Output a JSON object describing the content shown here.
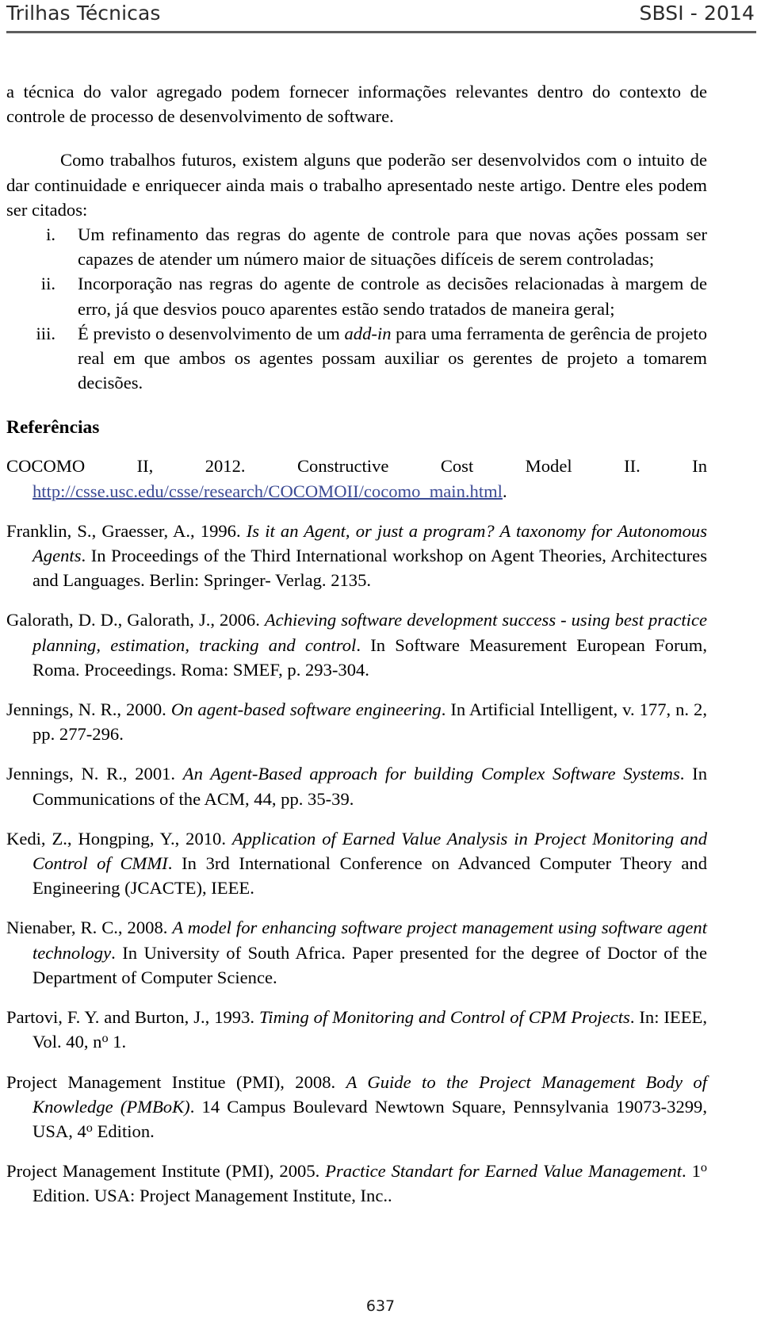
{
  "header": {
    "left": "Trilhas Técnicas",
    "right": "SBSI - 2014"
  },
  "body": {
    "paragraph_continued": "a técnica do valor agregado podem fornecer informações relevantes dentro do contexto de controle de processo de desenvolvimento de software.",
    "paragraph_future_work": "Como trabalhos futuros, existem alguns que poderão ser desenvolvidos com o intuito de dar continuidade e enriquecer ainda mais o trabalho apresentado neste artigo. Dentre eles podem ser citados:"
  },
  "list": {
    "items": [
      {
        "marker": "i.",
        "text": "Um refinamento das regras do agente de controle para que novas ações possam ser capazes de atender um número maior de situações difíceis de serem controladas;"
      },
      {
        "marker": "ii.",
        "text": "Incorporação nas regras do agente de controle as decisões relacionadas à margem de erro, já que desvios pouco aparentes estão sendo tratados de maneira geral;"
      },
      {
        "marker": "iii.",
        "text_before_italic": "É previsto o desenvolvimento de um ",
        "italic": "add-in",
        "text_after_italic": " para uma ferramenta de gerência de projeto real em que ambos os agentes possam auxiliar os gerentes de projeto a tomarem decisões."
      }
    ]
  },
  "references": {
    "heading": "Referências",
    "entries": [
      {
        "pre": "COCOMO  II,  2012.  Constructive  Cost  Model  II.  In ",
        "link": "http://csse.usc.edu/csse/research/COCOMOII/cocomo_main.html",
        "post": "."
      },
      {
        "pre": "Franklin, S., Graesser, A., 1996. ",
        "italic": "Is it an Agent, or just a program? A taxonomy for Autonomous Agents",
        "post": ". In Proceedings of the Third International workshop on Agent Theories, Architectures and Languages. Berlin: Springer- Verlag. 2135."
      },
      {
        "pre": "Galorath, D. D., Galorath, J., 2006. ",
        "italic": "Achieving software development success - using best practice planning, estimation, tracking and control",
        "post": ". In Software Measurement European Forum, Roma. Proceedings. Roma: SMEF, p. 293-304."
      },
      {
        "pre": "Jennings, N. R., 2000. ",
        "italic": "On agent-based software engineering",
        "post": ". In Artificial Intelligent, v. 177, n. 2, pp. 277-296."
      },
      {
        "pre": "Jennings, N. R., 2001. ",
        "italic": "An Agent-Based approach for building Complex Software Systems",
        "post": ". In Communications of the ACM, 44, pp. 35-39."
      },
      {
        "pre": "Kedi, Z., Hongping, Y., 2010. ",
        "italic": "Application of Earned Value Analysis in Project Monitoring and Control of CMMI",
        "post": ". In 3rd International Conference on Advanced Computer Theory and Engineering (JCACTE), IEEE."
      },
      {
        "pre": "Nienaber, R. C., 2008. ",
        "italic": "A model for enhancing software project management using software agent technology",
        "post": ". In University of South Africa. Paper presented for the degree of Doctor of the Department of Computer Science."
      },
      {
        "pre": "Partovi, F. Y. and Burton, J., 1993. ",
        "italic": "Timing of Monitoring and Control of CPM Projects",
        "post": ". In: IEEE, Vol. 40, n",
        "superscript": "o",
        "tail": " 1."
      },
      {
        "pre": "Project Management Institue (PMI), 2008. ",
        "italic": "A Guide to the Project Management Body of Knowledge (PMBoK)",
        "post": ". 14 Campus Boulevard Newtown Square, Pennsylvania 19073-3299, USA, 4",
        "superscript": "o",
        "tail": " Edition."
      },
      {
        "pre": "Project Management Institute (PMI), 2005. ",
        "italic": "Practice Standart for Earned Value Management",
        "post": ". 1",
        "superscript": "o",
        "tail": " Edition. USA: Project Management Institute, Inc.."
      }
    ]
  },
  "footer": {
    "page_number": "637"
  },
  "colors": {
    "link": "#3b4a93",
    "rule": "#5e5e5e",
    "text": "#000000"
  }
}
